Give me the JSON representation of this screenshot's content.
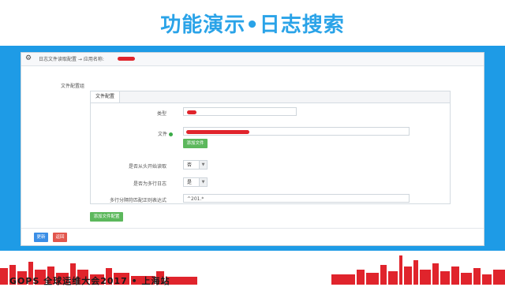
{
  "slide": {
    "title": "功能演示•日志搜索"
  },
  "panel": {
    "header_text": "日志文件读取配置 → 应用名称:"
  },
  "form": {
    "group_label": "文件配置组",
    "tab_label": "文件配置",
    "type_label": "类型",
    "file_label": "文件",
    "add_file_button": "添加文件",
    "read_from_start_label": "是否从头开始读取",
    "read_from_start_value": "否",
    "multiline_label": "是否为多行日志",
    "multiline_value": "是",
    "regex_label": "多行分隔符匹配正则表达式",
    "regex_value": "^201.*",
    "add_config_button": "添加文件配置"
  },
  "actions": {
    "update_button": "更新",
    "back_button": "返回"
  },
  "footer": {
    "text": "GOPS 全球运维大会2017 • 上海站"
  },
  "colors": {
    "accent_blue": "#1e9be6",
    "title_blue": "#2aa3e8",
    "redaction": "#e0242c",
    "green": "#5cb85c",
    "red": "#e2564d"
  }
}
